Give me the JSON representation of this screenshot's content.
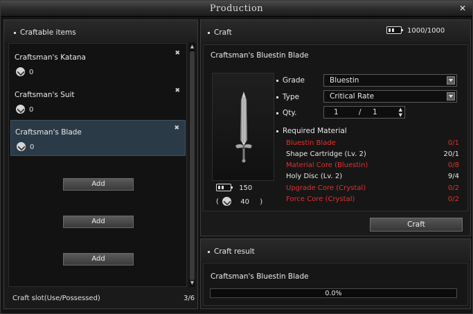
{
  "window": {
    "title": "Production"
  },
  "craftable": {
    "header": "Craftable items",
    "items": [
      {
        "name": "Craftsman's Katana",
        "count": "0",
        "selected": false
      },
      {
        "name": "Craftsman's Suit",
        "count": "0",
        "selected": false
      },
      {
        "name": "Craftsman's Blade",
        "count": "0",
        "selected": true
      }
    ],
    "add_buttons": [
      "Add",
      "Add",
      "Add"
    ],
    "slot_label": "Craft slot(Use/Possessed)",
    "slot_value": "3/6"
  },
  "craft": {
    "header": "Craft",
    "energy": "1000/1000",
    "item_title": "Craftsman's Bluestin Blade",
    "preview_energy": "150",
    "preview_tool_open": "(",
    "preview_tool": "40",
    "preview_tool_close": ")",
    "grade_label": "Grade",
    "grade_value": "Bluestin",
    "type_label": "Type",
    "type_value": "Critical Rate",
    "qty_label": "Qty.",
    "qty_value": "1",
    "qty_slash": "/",
    "qty_max": "1",
    "required_label": "Required Material",
    "materials": [
      {
        "name": "Bluestin Blade",
        "count": "0/1",
        "missing": true
      },
      {
        "name": "Shape Cartridge (Lv. 2)",
        "count": "20/1",
        "missing": false
      },
      {
        "name": "Material Core (Bluestin)",
        "count": "0/8",
        "missing": true
      },
      {
        "name": "Holy Disc (Lv. 2)",
        "count": "9/4",
        "missing": false
      },
      {
        "name": "Upgrade Core (Crystal)",
        "count": "0/2",
        "missing": true
      },
      {
        "name": "Force Core (Crystal)",
        "count": "0/2",
        "missing": true
      }
    ],
    "craft_button": "Craft"
  },
  "result": {
    "header": "Craft result",
    "item_title": "Craftsman's Bluestin Blade",
    "progress_text": "0.0%",
    "progress": 0.0
  },
  "colors": {
    "missing": "#e33030",
    "selected_row": "#2b3a47"
  }
}
